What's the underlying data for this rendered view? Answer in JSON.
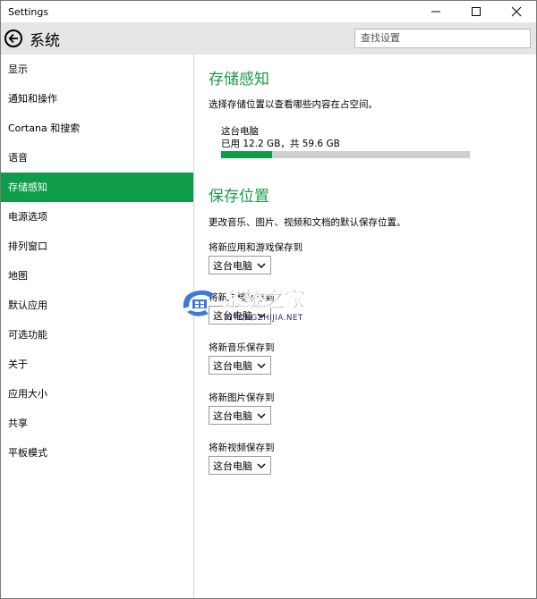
{
  "window": {
    "title": "Settings"
  },
  "header": {
    "title": "系统",
    "search_placeholder": "查找设置"
  },
  "sidebar": {
    "items": [
      {
        "label": "显示"
      },
      {
        "label": "通知和操作"
      },
      {
        "label": "Cortana 和搜索"
      },
      {
        "label": "语音"
      },
      {
        "label": "存储感知",
        "active": true
      },
      {
        "label": "电源选项"
      },
      {
        "label": "排列窗口"
      },
      {
        "label": "地图"
      },
      {
        "label": "默认应用"
      },
      {
        "label": "可选功能"
      },
      {
        "label": "关于"
      },
      {
        "label": "应用大小"
      },
      {
        "label": "共享"
      },
      {
        "label": "平板模式"
      }
    ]
  },
  "storage": {
    "title": "存储感知",
    "desc": "选择存储位置以查看哪些内容在占空间。",
    "drive_name": "这台电脑",
    "usage_text": "已用 12.2 GB，共 59.6 GB",
    "used_fraction": 0.205,
    "accent": "#0f9d49"
  },
  "save_locations": {
    "title": "保存位置",
    "desc": "更改音乐、图片、视频和文档的默认保存位置。",
    "items": [
      {
        "label": "将新应用和游戏保存到",
        "value": "这台电脑"
      },
      {
        "label": "将新文档保存到",
        "value": "这台电脑"
      },
      {
        "label": "将新音乐保存到",
        "value": "这台电脑"
      },
      {
        "label": "将新图片保存到",
        "value": "这台电脑"
      },
      {
        "label": "将新视频保存到",
        "value": "这台电脑"
      }
    ]
  },
  "watermark": {
    "name": "系统之家",
    "url": "XITONGZHIJIA.NET"
  }
}
